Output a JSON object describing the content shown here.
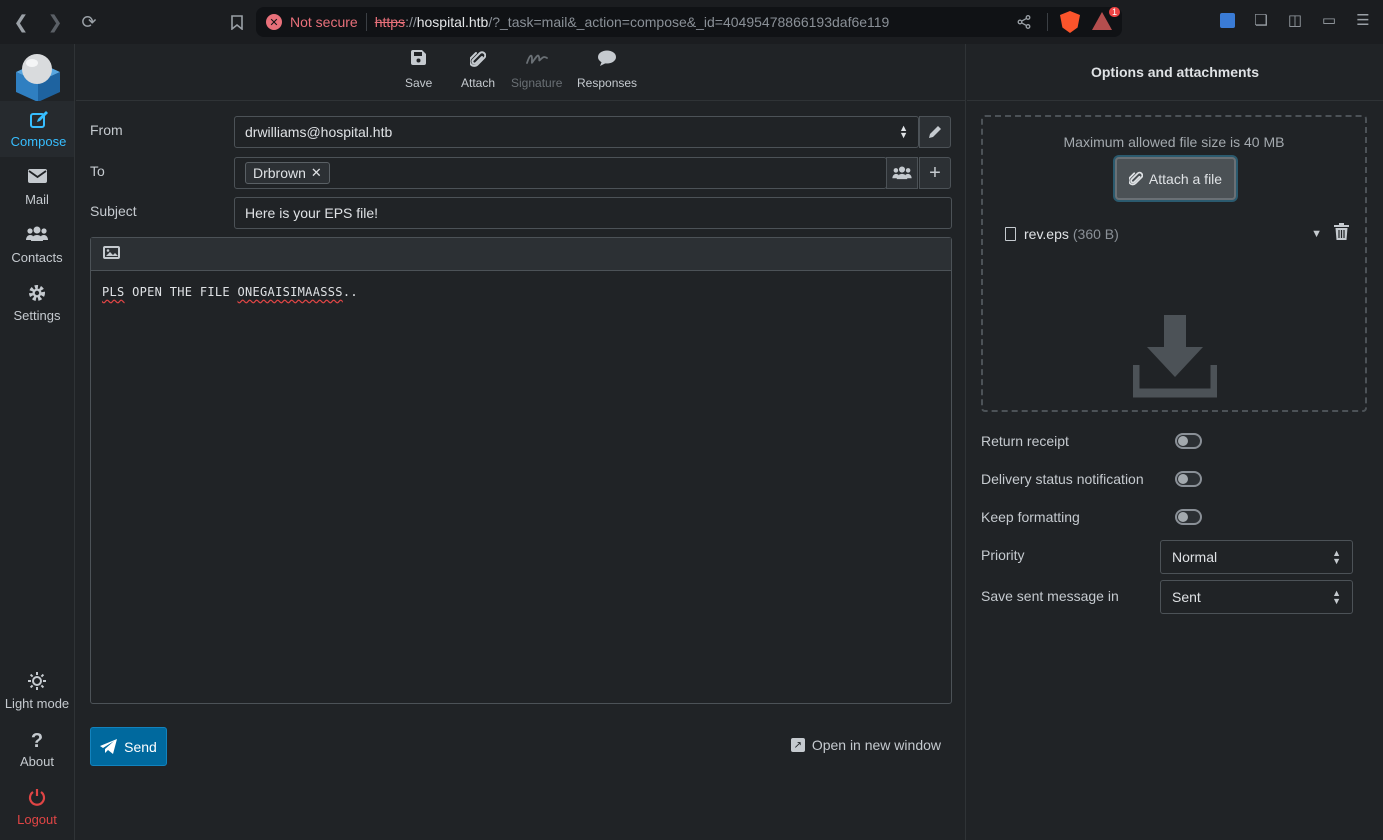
{
  "browser": {
    "security_label": "Not secure",
    "url_scheme": "https",
    "url_slash": "://",
    "url_host": "hospital.htb",
    "url_path": "/?_task=mail&_action=compose&_id=40495478866193daf6e119",
    "alert_badge": "1"
  },
  "appnav": {
    "items": [
      {
        "label": "Compose",
        "icon": "compose-icon"
      },
      {
        "label": "Mail",
        "icon": "envelope-icon"
      },
      {
        "label": "Contacts",
        "icon": "users-icon"
      },
      {
        "label": "Settings",
        "icon": "gear-icon"
      }
    ],
    "bottom": [
      {
        "label": "Light mode",
        "icon": "sun-icon"
      },
      {
        "label": "About",
        "icon": "question-icon"
      },
      {
        "label": "Logout",
        "icon": "power-icon"
      }
    ]
  },
  "toolbar": {
    "save": "Save",
    "attach": "Attach",
    "signature": "Signature",
    "responses": "Responses"
  },
  "compose": {
    "from_label": "From",
    "from_value": "drwilliams@hospital.htb",
    "to_label": "To",
    "recipients": [
      "Drbrown"
    ],
    "subject_label": "Subject",
    "subject_value": "Here is your EPS file!",
    "body_word1": "PLS",
    "body_middle": " OPEN THE FILE ",
    "body_word2": "ONEGAISIMAASSS",
    "body_end": "..",
    "send_label": "Send",
    "open_window_label": "Open in new window"
  },
  "options": {
    "header": "Options and attachments",
    "max_size": "Maximum allowed file size is 40 MB",
    "attach_button": "Attach a file",
    "attachment_name": "rev.eps",
    "attachment_size": "(360 B)",
    "return_receipt": "Return receipt",
    "delivery_status": "Delivery status notification",
    "keep_formatting": "Keep formatting",
    "priority_label": "Priority",
    "priority_value": "Normal",
    "save_sent_label": "Save sent message in",
    "save_sent_value": "Sent",
    "toggles": {
      "return_receipt": false,
      "delivery_status": false,
      "keep_formatting": false
    }
  },
  "colors": {
    "accent": "#37beff",
    "send": "#00699e",
    "logout": "#e04545",
    "insecure": "#e8707a"
  }
}
